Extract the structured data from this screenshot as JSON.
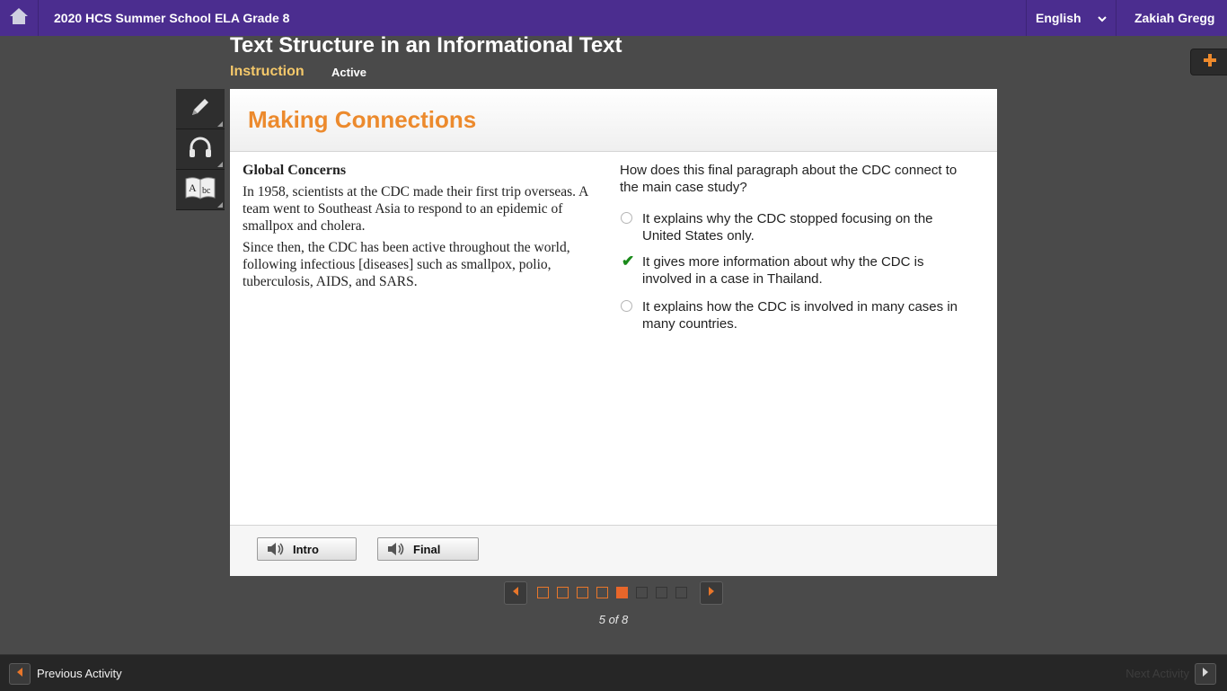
{
  "topbar": {
    "home_icon": "home-icon",
    "course_title": "2020 HCS Summer School ELA Grade 8",
    "language": "English",
    "user": "Zakiah Gregg"
  },
  "header": {
    "lesson_title": "Text Structure in an Informational Text",
    "tab_label": "Instruction",
    "status": "Active"
  },
  "tools": [
    {
      "icon": "pencil-icon"
    },
    {
      "icon": "headphones-icon"
    },
    {
      "icon": "dictionary-icon"
    }
  ],
  "card": {
    "title": "Making Connections",
    "passage": {
      "heading": "Global Concerns",
      "paragraphs": [
        "In 1958, scientists at the CDC made their first trip overseas. A team went to Southeast Asia to respond to an epidemic of smallpox and cholera.",
        "Since then, the CDC has been active throughout the world, following infectious [diseases] such as smallpox, polio, tuberculosis, AIDS, and SARS."
      ]
    },
    "question": "How does this final paragraph about the CDC connect to the main case study?",
    "choices": [
      {
        "text": "It explains why the CDC stopped focusing on the United States only.",
        "selected": false
      },
      {
        "text": "It gives more information about why the CDC is involved in a case in Thailand.",
        "selected": true
      },
      {
        "text": "It explains how the CDC is involved in many cases in many countries.",
        "selected": false
      }
    ],
    "audio_buttons": [
      "Intro",
      "Final"
    ]
  },
  "pager": {
    "current": 5,
    "total": 8,
    "label": "5 of 8"
  },
  "bottombar": {
    "previous": "Previous Activity",
    "next": "Next Activity"
  },
  "colors": {
    "topbar": "#4b2d8f",
    "accent_orange": "#ec8a2d",
    "tab_yellow": "#f4c86a",
    "check_green": "#1a8a1a",
    "background": "#4a4a4a"
  }
}
